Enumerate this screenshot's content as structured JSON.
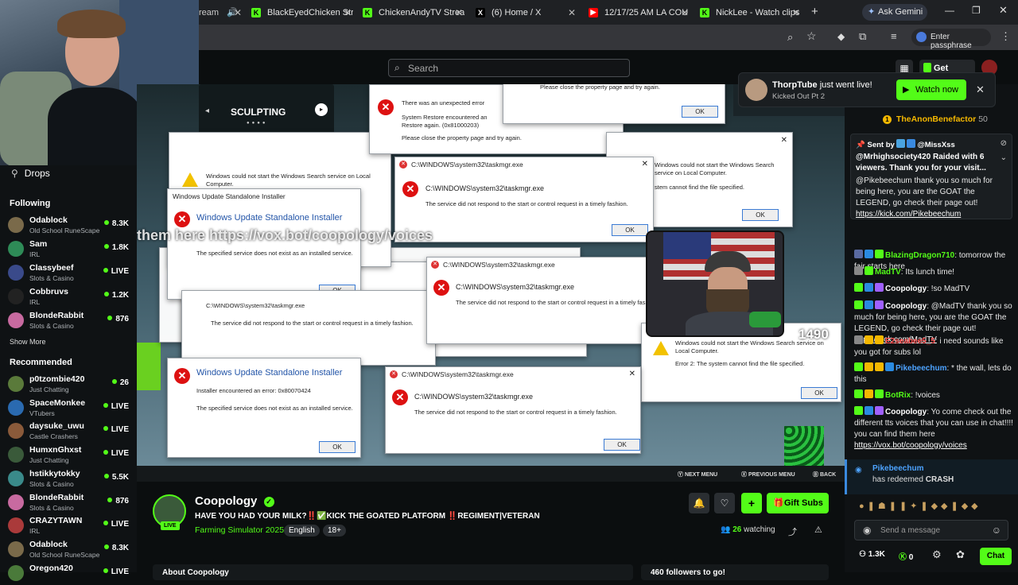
{
  "browser": {
    "tabs": [
      {
        "label": "BlackEyedChicken Stre",
        "fav": "K",
        "color": "#53fc18"
      },
      {
        "label": "ChickenAndyTV Strea",
        "fav": "K",
        "color": "#53fc18"
      },
      {
        "label": "(6) Home / X",
        "fav": "X",
        "color": "#000000"
      },
      {
        "label": "12/17/25 AM LA COU",
        "fav": "▶",
        "color": "#ff0000"
      },
      {
        "label": "NickLee - Watch clips",
        "fav": "K",
        "color": "#53fc18"
      }
    ],
    "ask_gemini": "Ask Gemini",
    "passphrase": "Enter passphrase"
  },
  "header": {
    "search_placeholder": "Search",
    "get_kicks": "Get KICKs"
  },
  "notification": {
    "user": "ThorpTube",
    "text": "just went live!",
    "subtitle": "Kicked Out Pt 2",
    "action": "Watch now"
  },
  "sidebar": {
    "drops": "Drops",
    "following_title": "Following",
    "following": [
      {
        "name": "Odablock",
        "category": "Old School RuneScape",
        "viewers": "8.3K",
        "color": "#7a6a4a"
      },
      {
        "name": "Sam",
        "category": "IRL",
        "viewers": "1.8K",
        "color": "#2e8b57"
      },
      {
        "name": "Classybeef",
        "category": "Slots & Casino",
        "viewers": "LIVE",
        "color": "#3a4a8a"
      },
      {
        "name": "Cobbruvs",
        "category": "IRL",
        "viewers": "1.2K",
        "color": "#222222"
      },
      {
        "name": "BlondeRabbit",
        "category": "Slots & Casino",
        "viewers": "876",
        "color": "#c86aa0"
      }
    ],
    "show_more": "Show More",
    "recommended_title": "Recommended",
    "recommended": [
      {
        "name": "p0tzombie420",
        "category": "Just Chatting",
        "viewers": "26",
        "color": "#5a7a3a"
      },
      {
        "name": "SpaceMonkee",
        "category": "VTubers",
        "viewers": "LIVE",
        "color": "#2a6ab0"
      },
      {
        "name": "daysuke_uwu",
        "category": "Castle Crashers",
        "viewers": "LIVE",
        "color": "#8a5a3a"
      },
      {
        "name": "HumxnGhxst",
        "category": "Just Chatting",
        "viewers": "LIVE",
        "color": "#3a5a3a"
      },
      {
        "name": "hstikkytokky",
        "category": "Slots & Casino",
        "viewers": "5.5K",
        "color": "#3a8a8a"
      },
      {
        "name": "BlondeRabbit",
        "category": "Slots & Casino",
        "viewers": "876",
        "color": "#c86aa0"
      },
      {
        "name": "CRAZYTAWN",
        "category": "IRL",
        "viewers": "LIVE",
        "color": "#aa3a3a"
      },
      {
        "name": "Odablock",
        "category": "Old School RuneScape",
        "viewers": "8.3K",
        "color": "#7a6a4a"
      },
      {
        "name": "Oregon420",
        "category": "",
        "viewers": "LIVE",
        "color": "#4a7a3a"
      }
    ]
  },
  "video": {
    "game_menu": "SCULPTING",
    "overlay_text": "them here https://vox.bot/coopology/voices",
    "viewer_count": "1490",
    "bottom_bar": [
      "NEXT MENU",
      "PREVIOUS MENU",
      "BACK"
    ],
    "dialogs": {
      "wu_title": "Windows Update Standalone Installer",
      "wu_error": "Installer encountered an error: 0x80070424",
      "wu_msg": "The specified service does not exist as an installed service.",
      "tm_title": "C:\\WINDOWS\\system32\\taskmgr.exe",
      "tm_msg": "The service did not respond to the start or control request in a timely fashion.",
      "ws_msg": "Windows could not start the Windows Search service on Local Computer.",
      "ws_err": "Error 2: The system cannot find the file specified.",
      "sr_msg1": "There was an unexpected error",
      "sr_msg2": "System Restore encountered an",
      "sr_msg3": "Restore again. (0x81000203)",
      "sr_msg4": "Please close the property page and try again.",
      "fs_msg": "stem cannot find the file specified.",
      "ok": "OK"
    }
  },
  "channel": {
    "name": "Coopology",
    "title": "HAVE YOU HAD YOUR MILK?‼️✅KICK THE GOATED PLATFORM ‼️REGIMENT|VETERAN",
    "category": "Farming Simulator 2025",
    "tags": [
      "English",
      "18+"
    ],
    "live": "LIVE",
    "watching_count": "26",
    "watching_label": "watching",
    "gift_subs": "Gift Subs",
    "about": "About Coopology",
    "followers_goal": "460 followers to go!"
  },
  "chat": {
    "top_gifter": {
      "name": "TheAnonBenefactor",
      "count": "50"
    },
    "pinned": {
      "sent_by_label": "Sent by",
      "sent_by": "@MissXss",
      "text": "@Mrhighsociety420 Raided with 6 viewers. Thank you for your visit..."
    },
    "messages": [
      {
        "user": "",
        "color": "#ffffff",
        "text": "@Pikebeechum thank you so much for being here, you are the GOAT the LEGEND, go check their page out!",
        "link": "https://kick.com/Pikebeechum"
      },
      {
        "user": "BlazingDragon710",
        "color": "#53fc18",
        "text": "tomorrow the fair starts here",
        "link": ""
      },
      {
        "user": "MadTV",
        "color": "#53fc18",
        "text": "Its lunch time!",
        "link": ""
      },
      {
        "user": "Coopology",
        "color": "#ffffff",
        "text": "!so MadTV",
        "link": ""
      },
      {
        "user": "Coopology",
        "color": "#ffffff",
        "text": "@MadTV thank you so much for being here, you are the GOAT the LEGEND, go check their page out!",
        "link": "https://kick.com/MadTV"
      },
      {
        "user": "E2seabee5_5",
        "color": "#ff4d4d",
        "text": "i need sounds like you got for subs lol",
        "link": ""
      },
      {
        "user": "Pikebeechum",
        "color": "#4da3ff",
        "text": "* the wall, lets do this",
        "link": ""
      },
      {
        "user": "BotRix",
        "color": "#53fc18",
        "text": "!voices",
        "link": ""
      },
      {
        "user": "Coopology",
        "color": "#ffffff",
        "text": "Yo come check out the different tts voices that you can use in chat!!!! you can find them here",
        "link": "https://vox.bot/coopology/voices"
      }
    ],
    "redeem": {
      "user": "Pikebeechum",
      "text": "has redeemed",
      "reward": "CRASH"
    },
    "input_placeholder": "Send a message",
    "footer": {
      "points": "1.3K",
      "kicks": "0",
      "chat_button": "Chat"
    }
  }
}
